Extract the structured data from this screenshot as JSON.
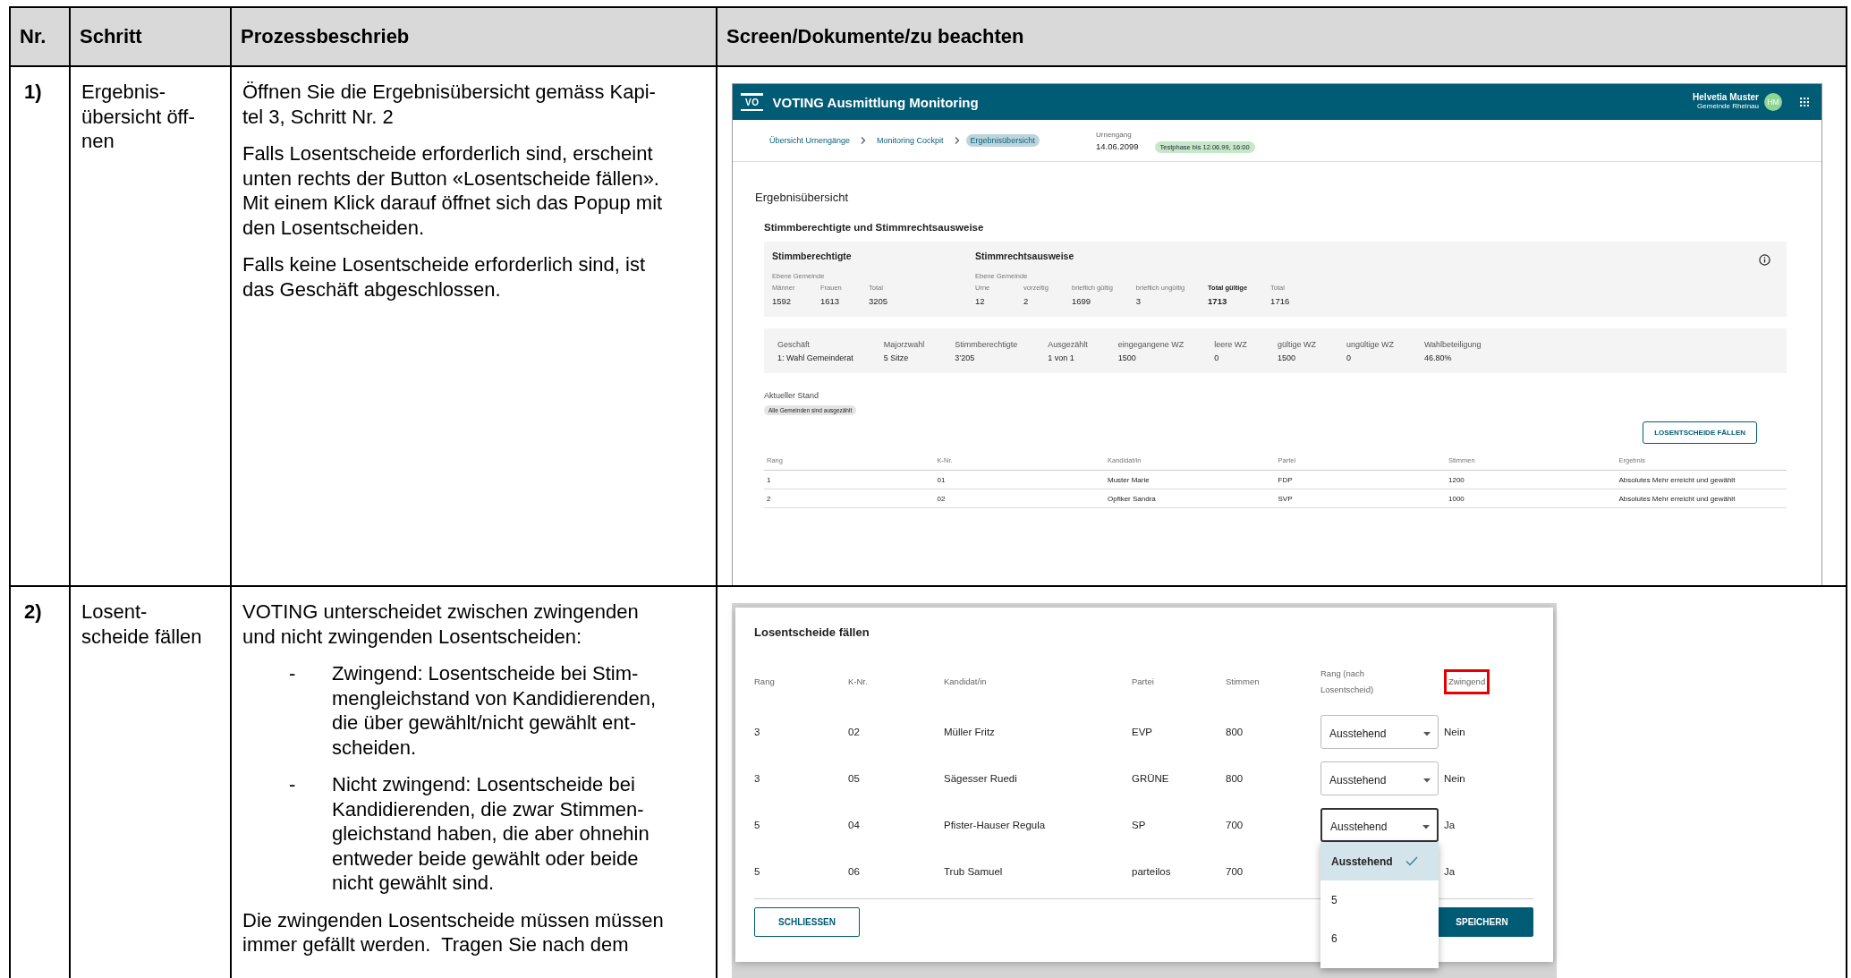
{
  "table": {
    "columns": [
      "Nr.",
      "Schritt",
      "Prozessbeschrieb",
      "Screen/Dokumente/zu beachten"
    ],
    "rows": [
      {
        "number": "1)",
        "step": "Ergebnis-\nübersicht öff-\nnen",
        "description": [
          {
            "kind": "paragraph",
            "text": "Öffnen Sie die Ergebnisübersicht gemäss Kapi-\ntel 3, Schritt Nr. 2"
          },
          {
            "kind": "paragraph",
            "text": "Falls Losentscheide erforderlich sind, erscheint\nunten rechts der Button «Losentscheide fällen».\nMit einem Klick darauf öffnet sich das Popup mit\nden Losentscheiden."
          },
          {
            "kind": "paragraph",
            "text": "Falls keine Losentscheide erforderlich sind, ist\ndas Geschäft abgeschlossen."
          }
        ],
        "screen": {
          "kind": "results_overview",
          "logo": "VO",
          "title": "VOTING Ausmittlung Monitoring",
          "user": {
            "name": "Helvetia Muster",
            "org": "Gemeinde Rheinau",
            "initials": "HM"
          },
          "breadcrumbs": [
            {
              "label": "Übersicht Urnengänge",
              "selected": false
            },
            {
              "label": "Monitoring Cockpit",
              "selected": false
            },
            {
              "label": "Ergebnisübersicht",
              "selected": true
            }
          ],
          "urnengang": {
            "label": "Urnengang",
            "date": "14.06.2099",
            "badge": "Testphase bis 12.06.99, 16:00"
          },
          "page_title": "Ergebnisübersicht",
          "section_title": "Stimmberechtigte und Stimmrechtsausweise",
          "voter_groups": [
            {
              "title": "Stimmberechtigte",
              "level_label": "Ebene Gemeinde",
              "fields": [
                {
                  "label": "Männer",
                  "value": "1592",
                  "emphasis": false
                },
                {
                  "label": "Frauen",
                  "value": "1613",
                  "emphasis": false
                },
                {
                  "label": "Total",
                  "value": "3205",
                  "emphasis": false
                }
              ]
            },
            {
              "title": "Stimmrechtsausweise",
              "level_label": "Ebene Gemeinde",
              "fields": [
                {
                  "label": "Urne",
                  "value": "12",
                  "emphasis": false
                },
                {
                  "label": "vorzeitig",
                  "value": "2",
                  "emphasis": false
                },
                {
                  "label": "brieflich gültig",
                  "value": "1699",
                  "emphasis": false
                },
                {
                  "label": "brieflich ungültig",
                  "value": "3",
                  "emphasis": false
                },
                {
                  "label": "Total gültige",
                  "value": "1713",
                  "emphasis": true
                },
                {
                  "label": "Total",
                  "value": "1716",
                  "emphasis": false
                }
              ]
            }
          ],
          "business": [
            {
              "label": "Geschäft",
              "value": "1: Wahl Gemeinderat"
            },
            {
              "label": "Majorzwahl",
              "value": "5 Sitze"
            },
            {
              "label": "Stimmberechtigte",
              "value": "3’205"
            },
            {
              "label": "Ausgezählt",
              "value": "1 von 1"
            },
            {
              "label": "eingegangene WZ",
              "value": "1500"
            },
            {
              "label": "leere WZ",
              "value": "0"
            },
            {
              "label": "gültige WZ",
              "value": "1500"
            },
            {
              "label": "ungültige WZ",
              "value": "0"
            },
            {
              "label": "Wahlbeteiligung",
              "value": "46.80%"
            }
          ],
          "status": {
            "label": "Aktueller Stand",
            "chip": "Alle Gemeinden sind ausgezählt"
          },
          "action_button": "LOSENTSCHEIDE FÄLLEN",
          "results": {
            "columns": [
              "Rang",
              "K-Nr.",
              "Kandidat/in",
              "Partei",
              "Stimmen",
              "Ergebnis"
            ],
            "rows": [
              [
                "1",
                "01",
                "Muster Marie",
                "FDP",
                "1200",
                "Absolutes Mehr erreicht und gewählt"
              ],
              [
                "2",
                "02",
                "Opfiker Sandra",
                "SVP",
                "1000",
                "Absolutes Mehr erreicht und gewählt"
              ]
            ]
          }
        }
      },
      {
        "number": "2)",
        "step": "Losent-\nscheide fällen",
        "description": [
          {
            "kind": "paragraph",
            "text": "VOTING unterscheidet zwischen zwingenden\nund nicht zwingenden Losentscheiden:"
          },
          {
            "kind": "bullet",
            "marker": "-",
            "text": "Zwingend: Losentscheide bei Stim-\nmengleichstand von Kandidierenden,\ndie über gewählt/nicht gewählt ent-\nscheiden."
          },
          {
            "kind": "bullet",
            "marker": "-",
            "text": "Nicht zwingend: Losentscheide bei\nKandidierenden, die zwar Stimmen-\ngleichstand haben, die aber ohnehin\nentweder beide gewählt oder beide\nnicht gewählt sind."
          },
          {
            "kind": "paragraph",
            "text": "Die zwingenden Losentscheide müssen müssen\nimmer gefällt werden.  Tragen Sie nach dem"
          }
        ],
        "screen": {
          "kind": "tie_break_dialog",
          "title": "Losentscheide fällen",
          "columns": [
            {
              "label": "Rang",
              "highlighted": false
            },
            {
              "label": "K-Nr.",
              "highlighted": false
            },
            {
              "label": "Kandidat/in",
              "highlighted": false
            },
            {
              "label": "Partei",
              "highlighted": false
            },
            {
              "label": "Stimmen",
              "highlighted": false
            },
            {
              "label": "Rang (nach Losentscheid)",
              "highlighted": false
            },
            {
              "label": "Zwingend",
              "highlighted": true
            }
          ],
          "rows": [
            {
              "rank": "3",
              "number": "02",
              "name": "Müller Fritz",
              "party": "EVP",
              "votes": "800",
              "rank_select": {
                "value": "Ausstehend",
                "focused": false
              },
              "mandatory": "Nein"
            },
            {
              "rank": "3",
              "number": "05",
              "name": "Sägesser Ruedi",
              "party": "GRÜNE",
              "votes": "800",
              "rank_select": {
                "value": "Ausstehend",
                "focused": false
              },
              "mandatory": "Nein"
            },
            {
              "rank": "5",
              "number": "04",
              "name": "Pfister-Hauser Regula",
              "party": "SP",
              "votes": "700",
              "rank_select": {
                "value": "Ausstehend",
                "focused": true,
                "menu": [
                  {
                    "label": "Ausstehend",
                    "selected": true
                  },
                  {
                    "label": "5",
                    "selected": false
                  },
                  {
                    "label": "6",
                    "selected": false
                  }
                ]
              },
              "mandatory": "Ja"
            },
            {
              "rank": "5",
              "number": "06",
              "name": "Trub Samuel",
              "party": "parteilos",
              "votes": "700",
              "mandatory": "Ja"
            }
          ],
          "buttons": [
            {
              "label": "SCHLIESSEN",
              "kind": "outlined"
            },
            {
              "label": "SPEICHERN",
              "kind": "filled"
            }
          ]
        }
      }
    ]
  }
}
